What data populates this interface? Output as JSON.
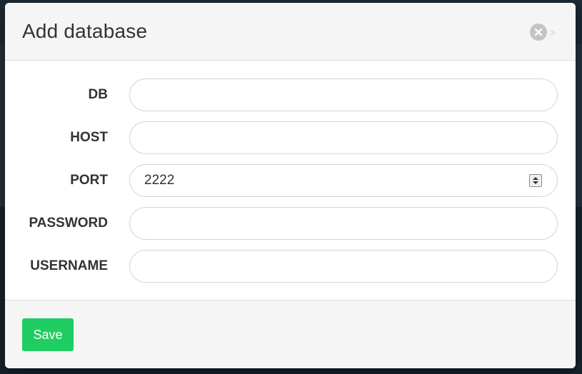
{
  "dialog": {
    "title": "Add database",
    "close_icon": "close-circle-icon"
  },
  "fields": [
    {
      "label": "DB",
      "value": "",
      "type": "text"
    },
    {
      "label": "HOST",
      "value": "",
      "type": "text"
    },
    {
      "label": "PORT",
      "value": "2222",
      "type": "number"
    },
    {
      "label": "PASSWORD",
      "value": "",
      "type": "password"
    },
    {
      "label": "USERNAME",
      "value": "",
      "type": "text"
    }
  ],
  "footer": {
    "save_label": "Save"
  },
  "colors": {
    "save_button": "#1fcd62",
    "header_bg": "#f5f5f5",
    "backdrop": "#17232c"
  }
}
